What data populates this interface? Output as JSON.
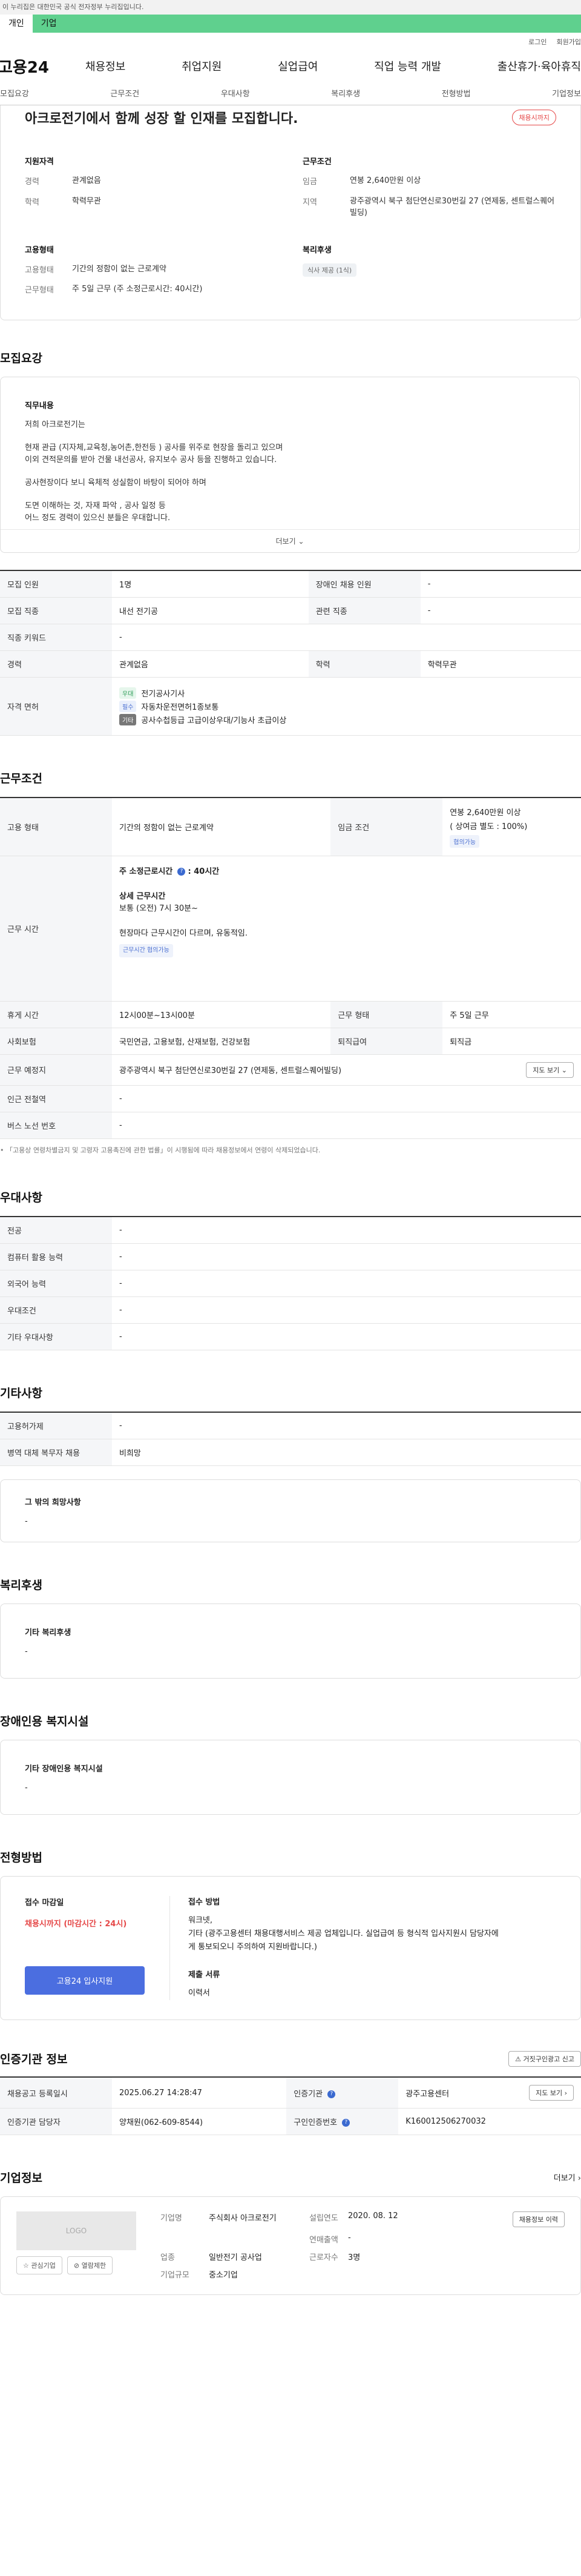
{
  "gov_banner": "이 누리집은 대한민국 공식 전자정부 누리집입니다.",
  "top_tabs": [
    "개인",
    "기업"
  ],
  "util": {
    "login": "로그인",
    "join": "회원가입"
  },
  "gnb": {
    "logo": "고용24",
    "menu": [
      "채용정보",
      "취업지원",
      "실업급여",
      "직업 능력 개발",
      "출산휴가·육아휴직"
    ]
  },
  "anchor": [
    "모집요강",
    "근무조건",
    "우대사항",
    "복리후생",
    "전형방법",
    "기업정보"
  ],
  "summary": {
    "title": "아크로전기에서 함께 성장 할 인재를 모집합니다.",
    "status": "채용시까지",
    "qual_title": "지원자격",
    "career_k": "경력",
    "career_v": "관계없음",
    "edu_k": "학력",
    "edu_v": "학력무관",
    "work_title": "근무조건",
    "wage_k": "임금",
    "wage_v": "연봉 2,640만원 이상",
    "region_k": "지역",
    "region_v": "광주광역시 북구 첨단연신로30번길 27 (연제동, 센트럴스퀘어빌딩)",
    "emp_title": "고용형태",
    "emptype_k": "고용형태",
    "emptype_v": "기간의 정함이 없는 근로계약",
    "hours_k": "근무형태",
    "hours_v": "주 5일 근무 (주 소정근로시간: 40시간)",
    "welfare_title": "복리후생",
    "welfare_chip": "식사 제공 (1식)"
  },
  "recruit": {
    "title": "모집요강",
    "duty_title": "직무내용",
    "duty_lines": [
      "저희 아크로전기는",
      "",
      "현재 관급 (지자체,교육청,농어촌,한전등 ) 공사를 위주로 현장을 돌리고 있으며",
      "이외 견적문의를 받아 건물 내선공사, 유지보수 공사 등을 진행하고 있습니다.",
      "",
      "공사현장이다 보니 육체적 성실함이 바탕이 되어야 하며",
      "",
      "도면 이해하는 것, 자재 파악 , 공사 일정 등",
      "어느 정도 경력이 있으신 분들은 우대합니다."
    ],
    "more": "더보기",
    "rows": {
      "count_k": "모집 인원",
      "count_v": "1명",
      "disabled_k": "장애인 채용 인원",
      "disabled_v": "-",
      "job_k": "모집 직종",
      "job_v": "내선 전기공",
      "related_k": "관련 직종",
      "related_v": "-",
      "keyword_k": "직종 키워드",
      "keyword_v": "-",
      "career_k": "경력",
      "career_v": "관계없음",
      "edu_k": "학력",
      "edu_v": "학력무관",
      "license_k": "자격 면허"
    },
    "licenses": [
      {
        "tag": "우대",
        "name": "전기공사기사"
      },
      {
        "tag": "필수",
        "name": "자동차운전면허1종보통"
      },
      {
        "tag": "기타",
        "name": "공사수첩등급 고급이상우대/기능사 초급이상"
      }
    ]
  },
  "conditions": {
    "title": "근무조건",
    "emptype_k": "고용 형태",
    "emptype_v": "기간의 정함이 없는 근로계약",
    "wage_k": "임금 조건",
    "wage_v": "연봉 2,640만원 이상",
    "wage_sub": "( 상여금 별도 : 100%)",
    "wage_chip": "협의가능",
    "hours_k": "근무 시간",
    "hours_week": "주 소정근로시간",
    "hours_week_v": ": 40시간",
    "hours_detail_title": "상세 근무시간",
    "hours_detail": "보통 (오전) 7시 30분~",
    "hours_note": "현장마다 근무시간이 다르며, 유동적임.",
    "hours_chip": "근무시간 협의가능",
    "break_k": "휴게 시간",
    "break_v": "12시00분~13시00분",
    "worktype_k": "근무 형태",
    "worktype_v": "주 5일 근무",
    "insurance_k": "사회보험",
    "insurance_v": "국민연금, 고용보험, 산재보험, 건강보험",
    "retire_k": "퇴직급여",
    "retire_v": "퇴직금",
    "place_k": "근무 예정지",
    "place_v": "광주광역시 북구 첨단연신로30번길 27 (연제동, 센트럴스퀘어빌딩)",
    "map_btn": "지도 보기",
    "station_k": "인근 전철역",
    "station_v": "-",
    "bus_k": "버스 노선 번호",
    "bus_v": "-",
    "note": "「고용상 연령차별금지 및 고령자 고용촉진에 관한 법률」이 시행됨에 따라 채용정보에서 연령이 삭제되었습니다."
  },
  "preference": {
    "title": "우대사항",
    "rows": [
      {
        "k": "전공",
        "v": "-"
      },
      {
        "k": "컴퓨터 활용 능력",
        "v": "-"
      },
      {
        "k": "외국어 능력",
        "v": "-"
      },
      {
        "k": "우대조건",
        "v": "-"
      },
      {
        "k": "기타 우대사항",
        "v": "-"
      }
    ]
  },
  "etc": {
    "title": "기타사항",
    "rows": [
      {
        "k": "고용허가제",
        "v": "-"
      },
      {
        "k": "병역 대체 복무자 채용",
        "v": "비희망"
      }
    ],
    "box_title": "그 밖의 희망사항",
    "box_v": "-"
  },
  "welfare": {
    "title": "복리후생",
    "box_title": "기타 복리후생",
    "box_v": "-"
  },
  "disabled_fac": {
    "title": "장애인용 복지시설",
    "box_title": "기타 장애인용 복지시설",
    "box_v": "-"
  },
  "apply": {
    "title": "전형방법",
    "deadline_title": "접수 마감일",
    "deadline_v": "채용시까지 (마감시간 : 24시)",
    "btn": "고용24 입사지원",
    "method_title": "접수 방법",
    "method_lines": [
      "워크넷,",
      "기타 (광주고용센터 채용대행서비스 제공 업체입니다. 실업급여 등 형식적 입사지원시 담당자에",
      "게 통보되오니 주의하여 지원바랍니다.)"
    ],
    "docs_title": "제출 서류",
    "docs_v": "이력서"
  },
  "agency": {
    "title": "인증기관 정보",
    "report_btn": "거짓구인광고 신고",
    "reg_k": "채용공고 등록일시",
    "reg_v": "2025.06.27 14:28:47",
    "org_k": "인증기관",
    "org_v": "광주고용센터",
    "map_btn": "지도 보기",
    "person_k": "인증기관 담당자",
    "person_v": "양채원(062-609-8544)",
    "no_k": "구인인증번호",
    "no_v": "K160012506270032"
  },
  "company": {
    "title": "기업정보",
    "more": "더보기",
    "logo": "LOGO",
    "fav_btn": "관심기업",
    "block_btn": "열람제한",
    "name_k": "기업명",
    "name_v": "주식회사 아크로전기",
    "founded_k": "설립연도",
    "founded_v": "2020. 08. 12",
    "jobs_btn": "채용정보 이력",
    "sales_k": "연매출액",
    "sales_v": "-",
    "industry_k": "업종",
    "industry_v": "일반전기 공사업",
    "employees_k": "근로자수",
    "employees_v": "3명",
    "scale_k": "기업규모",
    "scale_v": "중소기업"
  }
}
